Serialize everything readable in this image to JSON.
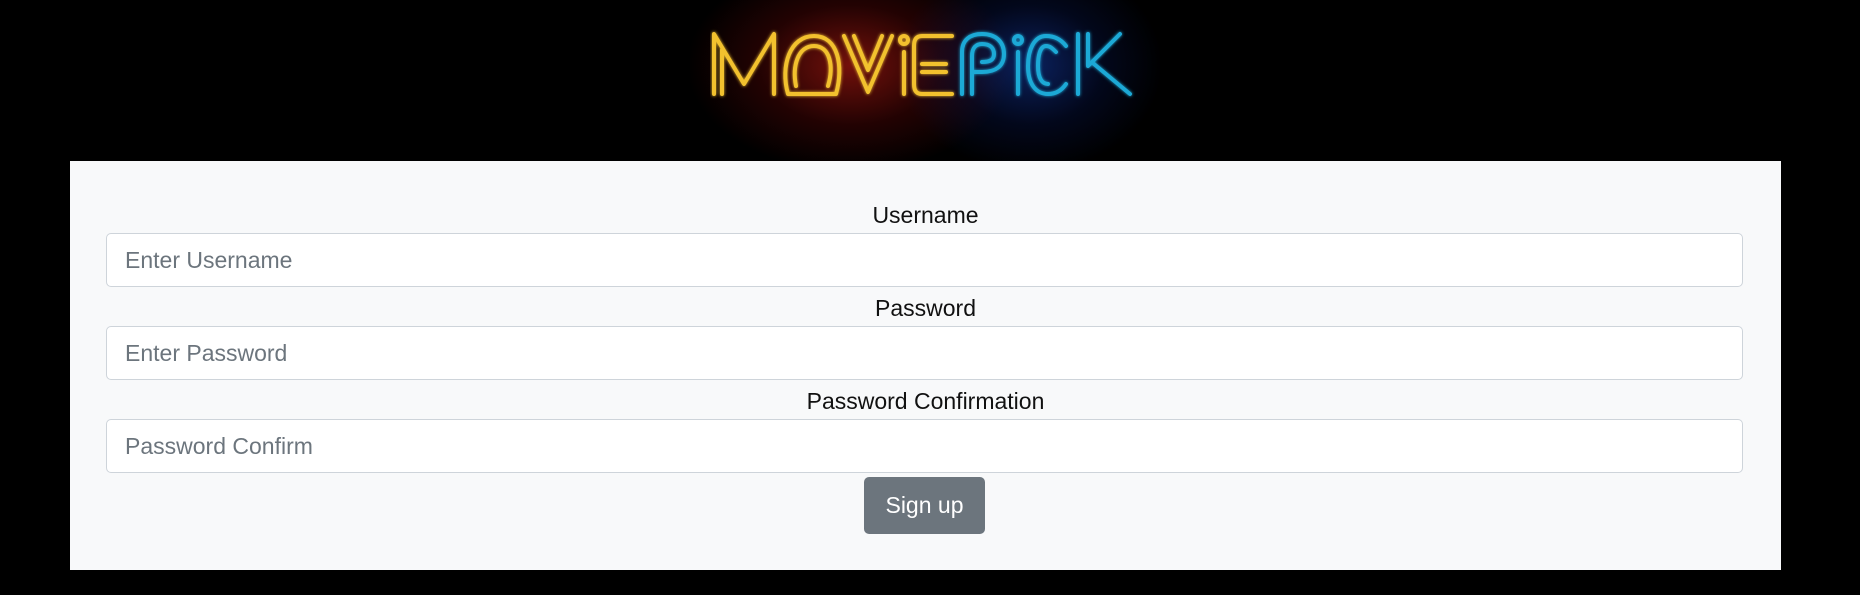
{
  "logo": {
    "text_part1": "MOVIE",
    "text_part2": "PICK",
    "color_part1": "#f2c12e",
    "color_part2": "#1fa9d6"
  },
  "form": {
    "username": {
      "label": "Username",
      "placeholder": "Enter Username",
      "value": ""
    },
    "password": {
      "label": "Password",
      "placeholder": "Enter Password",
      "value": ""
    },
    "password_confirmation": {
      "label": "Password Confirmation",
      "placeholder": "Password Confirm",
      "value": ""
    },
    "submit_label": "Sign up"
  },
  "colors": {
    "page_background": "#000000",
    "panel_background": "#f8f9fa",
    "button_background": "#6c757d",
    "input_border": "#ced4da"
  }
}
